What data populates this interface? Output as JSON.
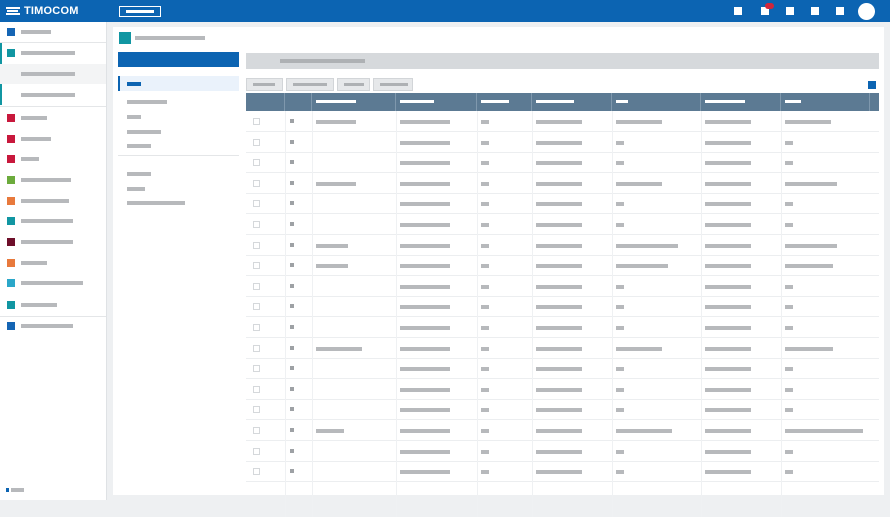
{
  "app": {
    "brand": "TIMOCOM"
  },
  "colors": {
    "brand_blue": "#0c64b2",
    "table_header": "#5c7a93",
    "placeholder_grey": "#b7b9bc",
    "alert_red": "#d0263c"
  },
  "topbar": {
    "icons": [
      "notification-icon",
      "messages-icon",
      "menu-icon-1",
      "menu-icon-2",
      "menu-icon-3"
    ],
    "has_notification_badge": true
  },
  "sidebar": {
    "items": [
      {
        "color": "#1565b4",
        "name": "sidebar-item-1"
      },
      {
        "color": "#1196a2",
        "name": "sidebar-item-2",
        "expanded": true
      },
      {
        "color": "#c8183c",
        "name": "sidebar-item-3"
      },
      {
        "color": "#c8183c",
        "name": "sidebar-item-4"
      },
      {
        "color": "#c8183c",
        "name": "sidebar-item-5"
      },
      {
        "color": "#6cab3c",
        "name": "sidebar-item-6"
      },
      {
        "color": "#e8793c",
        "name": "sidebar-item-7"
      },
      {
        "color": "#1196a2",
        "name": "sidebar-item-8"
      },
      {
        "color": "#6e0f2a",
        "name": "sidebar-item-9"
      },
      {
        "color": "#e8793c",
        "name": "sidebar-item-10"
      },
      {
        "color": "#2ba7c9",
        "name": "sidebar-item-11"
      },
      {
        "color": "#1196a2",
        "name": "sidebar-item-12"
      },
      {
        "color": "#1565b4",
        "name": "sidebar-item-13"
      }
    ]
  },
  "page": {
    "icon_color": "#1196a2"
  },
  "table": {
    "row_count": 18,
    "toolbar_buttons": 4
  }
}
